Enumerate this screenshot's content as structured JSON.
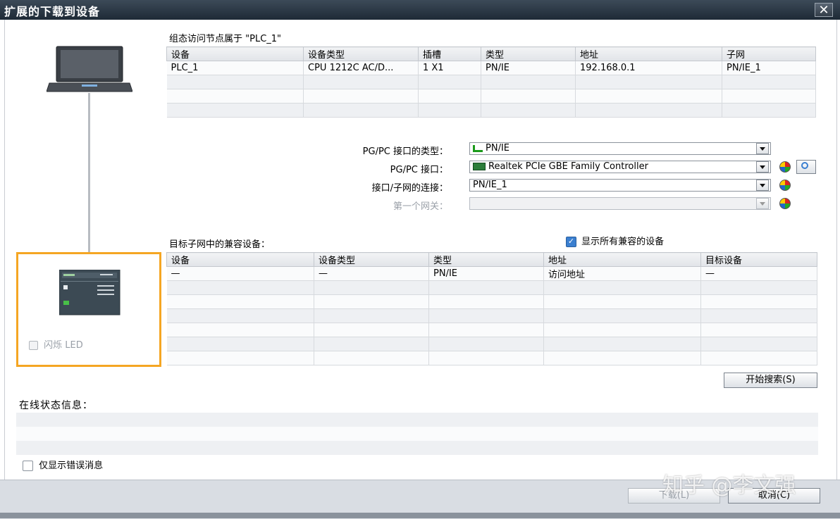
{
  "window": {
    "title": "扩展的下载到设备",
    "close_glyph": "✕"
  },
  "configured": {
    "heading": "组态访问节点属于 \"PLC_1\"",
    "columns": [
      "设备",
      "设备类型",
      "插槽",
      "类型",
      "地址",
      "子网"
    ],
    "rows": [
      [
        "PLC_1",
        "CPU 1212C AC/D...",
        "1 X1",
        "PN/IE",
        "192.168.0.1",
        "PN/IE_1"
      ],
      [
        "",
        "",
        "",
        "",
        "",
        ""
      ],
      [
        "",
        "",
        "",
        "",
        "",
        ""
      ],
      [
        "",
        "",
        "",
        "",
        "",
        ""
      ]
    ]
  },
  "interface": {
    "type_label": "PG/PC 接口的类型：",
    "type_value": "PN/IE",
    "iface_label": "PG/PC 接口：",
    "iface_value": "Realtek PCIe GBE Family Controller",
    "subnet_label": "接口/子网的连接：",
    "subnet_value": "PN/IE_1",
    "gateway_label": "第一个网关：",
    "gateway_value": ""
  },
  "compatible": {
    "heading": "目标子网中的兼容设备：",
    "show_all_label": "显示所有兼容的设备",
    "show_all_checked": true,
    "columns": [
      "设备",
      "设备类型",
      "类型",
      "地址",
      "目标设备"
    ],
    "rows": [
      [
        "—",
        "—",
        "PN/IE",
        "访问地址",
        "—"
      ],
      [
        "",
        "",
        "",
        "",
        ""
      ],
      [
        "",
        "",
        "",
        "",
        ""
      ],
      [
        "",
        "",
        "",
        "",
        ""
      ],
      [
        "",
        "",
        "",
        "",
        ""
      ],
      [
        "",
        "",
        "",
        "",
        ""
      ],
      [
        "",
        "",
        "",
        "",
        ""
      ]
    ]
  },
  "flash_led_label": "闪烁 LED",
  "start_search_label": "开始搜索(S)",
  "status": {
    "heading": "在线状态信息：",
    "only_errors_label": "仅显示错误消息"
  },
  "buttons": {
    "download": "下载(L)",
    "cancel": "取消(C)"
  },
  "watermark": "知乎 @李文强",
  "colors": {
    "accent_orange": "#f5a623",
    "title_bar": "#2a3744",
    "checkbox_blue": "#3a7fd0"
  }
}
